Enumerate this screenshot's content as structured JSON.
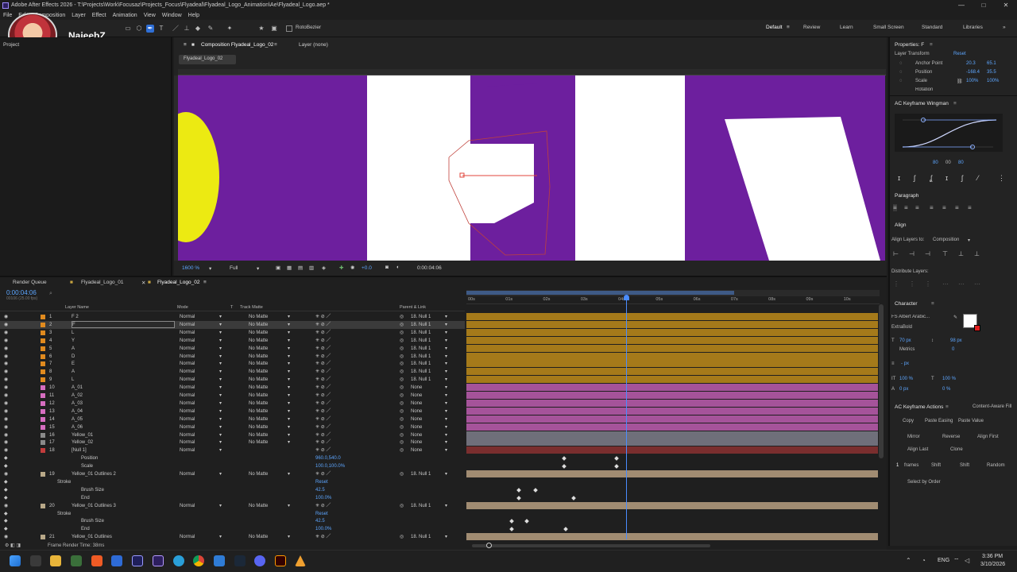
{
  "window": {
    "title": "Adobe After Effects 2026 - T:\\Projects\\Work\\Focusaz\\Projects_Focus\\Flyadeal\\Flyadeal_Logo_Animation\\Ae\\Flyadeal_Logo.aep *",
    "minimize": "—",
    "maximize": "□",
    "close": "✕"
  },
  "menu": [
    "File",
    "Edit",
    "Composition",
    "Layer",
    "Effect",
    "Animation",
    "View",
    "Window",
    "Help"
  ],
  "streamer": {
    "name": "NajeebZ"
  },
  "toolbar": {
    "rotobezier": "RotoBezier"
  },
  "workspaces": [
    "Default",
    "Review",
    "Learn",
    "Small Screen",
    "Standard",
    "Libraries"
  ],
  "left_panel": {
    "tab": "Project"
  },
  "composition": {
    "tab": "Composition Flyadeal_Logo_02",
    "layer_tab": "Layer (none)",
    "comp_chip": "Flyadeal_Logo_02",
    "zoom": "1600 %",
    "resolution": "Full",
    "exposure": "+0.0",
    "timecode": "0:00:04:06"
  },
  "properties": {
    "title": "Properties: F",
    "layer_transform": "Layer Transform",
    "reset": "Reset",
    "rows": [
      {
        "label": "Anchor Point",
        "v1": "20.3",
        "v2": "65.1"
      },
      {
        "label": "Position",
        "v1": "-168.4",
        "v2": "35.5"
      },
      {
        "label": "Scale",
        "v1": "100%",
        "v2": "100%"
      },
      {
        "label": "Rotation",
        "v1": "",
        "v2": ""
      }
    ]
  },
  "keyframe_wingman": {
    "title": "AC Keyframe Wingman",
    "values": [
      "80",
      "00",
      "80"
    ]
  },
  "paragraph": {
    "title": "Paragraph"
  },
  "align": {
    "title": "Align",
    "align_to_label": "Align Layers to:",
    "align_to": "Composition",
    "distribute": "Distribute Layers:"
  },
  "character": {
    "title": "Character",
    "font": "FS Albert Arabic...",
    "style": "ExtraBold",
    "size": "70 px",
    "leading": "98 px",
    "tracking_label": "Metrics",
    "tracking": "0",
    "stroke": "- px",
    "vscale": "100 %",
    "hscale": "100 %",
    "baseline": "0 px",
    "tsume": "0 %"
  },
  "keyframe_actions": {
    "title": "AC Keyframe Actions",
    "fill_tab": "Content-Aware Fill",
    "row1": [
      "Copy",
      "Paste Easing",
      "Paste Value"
    ],
    "row2": [
      "Mirror",
      "Reverse",
      "Align First"
    ],
    "row3": [
      "Align Last",
      "Clone"
    ],
    "row4": [
      "1",
      "frames",
      "Shift",
      "Shift",
      "Random"
    ],
    "select_by": "Select by Order"
  },
  "timeline": {
    "tabs": [
      "Render Queue",
      "Flyadeal_Logo_01",
      "Flyadeal_Logo_02"
    ],
    "timecode": "0:00:04:06",
    "fps": "00106 (25.00 fps)",
    "headers": {
      "layer": "Layer Name",
      "mode": "Mode",
      "t": "T",
      "trackmatte": "Track Matte",
      "parent": "Parent & Link"
    },
    "ruler": [
      "00s",
      "01s",
      "02s",
      "03s",
      "04s",
      "05s",
      "06s",
      "07s",
      "08s",
      "09s",
      "10s"
    ],
    "layers": [
      {
        "num": "1",
        "name": "F 2",
        "mode": "Normal",
        "matte": "No Matte",
        "parent": "18. Null 1",
        "color": "#e08a1e",
        "bar": "#a57a1a"
      },
      {
        "num": "2",
        "name": "F",
        "mode": "Normal",
        "matte": "No Matte",
        "parent": "18. Null 1",
        "color": "#e08a1e",
        "bar": "#a57a1a",
        "selected": true
      },
      {
        "num": "3",
        "name": "L",
        "mode": "Normal",
        "matte": "No Matte",
        "parent": "18. Null 1",
        "color": "#e08a1e",
        "bar": "#a57a1a"
      },
      {
        "num": "4",
        "name": "Y",
        "mode": "Normal",
        "matte": "No Matte",
        "parent": "18. Null 1",
        "color": "#e08a1e",
        "bar": "#a57a1a"
      },
      {
        "num": "5",
        "name": "A",
        "mode": "Normal",
        "matte": "No Matte",
        "parent": "18. Null 1",
        "color": "#e08a1e",
        "bar": "#a57a1a"
      },
      {
        "num": "6",
        "name": "D",
        "mode": "Normal",
        "matte": "No Matte",
        "parent": "18. Null 1",
        "color": "#e08a1e",
        "bar": "#a57a1a"
      },
      {
        "num": "7",
        "name": "E",
        "mode": "Normal",
        "matte": "No Matte",
        "parent": "18. Null 1",
        "color": "#e08a1e",
        "bar": "#a57a1a"
      },
      {
        "num": "8",
        "name": "A",
        "mode": "Normal",
        "matte": "No Matte",
        "parent": "18. Null 1",
        "color": "#e08a1e",
        "bar": "#a57a1a"
      },
      {
        "num": "9",
        "name": "L",
        "mode": "Normal",
        "matte": "No Matte",
        "parent": "18. Null 1",
        "color": "#e08a1e",
        "bar": "#a57a1a"
      },
      {
        "num": "10",
        "name": "A_01",
        "mode": "Normal",
        "matte": "No Matte",
        "parent": "None",
        "color": "#d66dc0",
        "bar": "#a5539a"
      },
      {
        "num": "11",
        "name": "A_02",
        "mode": "Normal",
        "matte": "No Matte",
        "parent": "None",
        "color": "#d66dc0",
        "bar": "#a5539a"
      },
      {
        "num": "12",
        "name": "A_03",
        "mode": "Normal",
        "matte": "No Matte",
        "parent": "None",
        "color": "#d66dc0",
        "bar": "#a5539a"
      },
      {
        "num": "13",
        "name": "A_04",
        "mode": "Normal",
        "matte": "No Matte",
        "parent": "None",
        "color": "#d66dc0",
        "bar": "#a5539a"
      },
      {
        "num": "14",
        "name": "A_05",
        "mode": "Normal",
        "matte": "No Matte",
        "parent": "None",
        "color": "#d66dc0",
        "bar": "#a5539a"
      },
      {
        "num": "15",
        "name": "A_06",
        "mode": "Normal",
        "matte": "No Matte",
        "parent": "None",
        "color": "#d66dc0",
        "bar": "#a5539a"
      },
      {
        "num": "16",
        "name": "Yellow_01",
        "mode": "Normal",
        "matte": "No Matte",
        "parent": "None",
        "color": "#8a8a8a",
        "bar": "#6f6f7a"
      },
      {
        "num": "17",
        "name": "Yellow_02",
        "mode": "Normal",
        "matte": "No Matte",
        "parent": "None",
        "color": "#8a8a8a",
        "bar": "#6f6f7a"
      },
      {
        "num": "18",
        "name": "[Null 1]",
        "mode": "Normal",
        "matte": "",
        "parent": "None",
        "color": "#c23c3c",
        "bar": "#7a2e2e"
      },
      {
        "num": "",
        "name": "Position",
        "mode": "",
        "matte": "",
        "parent": "",
        "value": "960.0,540.0",
        "color": "",
        "bar": ""
      },
      {
        "num": "",
        "name": "Scale",
        "mode": "",
        "matte": "",
        "parent": "",
        "value": "100.0,100.0%",
        "color": "",
        "bar": ""
      },
      {
        "num": "19",
        "name": "Yellow_01 Outlines 2",
        "mode": "Normal",
        "matte": "No Matte",
        "parent": "18. Null 1",
        "color": "#b8a888",
        "bar": "#a18c72"
      },
      {
        "num": "",
        "name": "Stroke",
        "mode": "",
        "matte": "",
        "parent": "",
        "value": "Reset",
        "color": "",
        "bar": ""
      },
      {
        "num": "",
        "name": "Brush Size",
        "mode": "",
        "matte": "",
        "parent": "",
        "value": "42.5",
        "color": "",
        "bar": ""
      },
      {
        "num": "",
        "name": "End",
        "mode": "",
        "matte": "",
        "parent": "",
        "value": "100.0%",
        "color": "",
        "bar": ""
      },
      {
        "num": "20",
        "name": "Yellow_01 Outlines 3",
        "mode": "Normal",
        "matte": "No Matte",
        "parent": "18. Null 1",
        "color": "#b8a888",
        "bar": "#a18c72"
      },
      {
        "num": "",
        "name": "Stroke",
        "mode": "",
        "matte": "",
        "parent": "",
        "value": "Reset",
        "color": "",
        "bar": ""
      },
      {
        "num": "",
        "name": "Brush Size",
        "mode": "",
        "matte": "",
        "parent": "",
        "value": "42.5",
        "color": "",
        "bar": ""
      },
      {
        "num": "",
        "name": "End",
        "mode": "",
        "matte": "",
        "parent": "",
        "value": "100.0%",
        "color": "",
        "bar": ""
      },
      {
        "num": "21",
        "name": "Yellow_01 Outlines",
        "mode": "Normal",
        "matte": "No Matte",
        "parent": "18. Null 1",
        "color": "#b8a888",
        "bar": "#a18c72"
      }
    ],
    "frame_render_time": "Frame Render Time: 38ms"
  },
  "taskbar": {
    "lang": "ENG",
    "time": "3:36 PM",
    "date": "3/10/2026"
  }
}
